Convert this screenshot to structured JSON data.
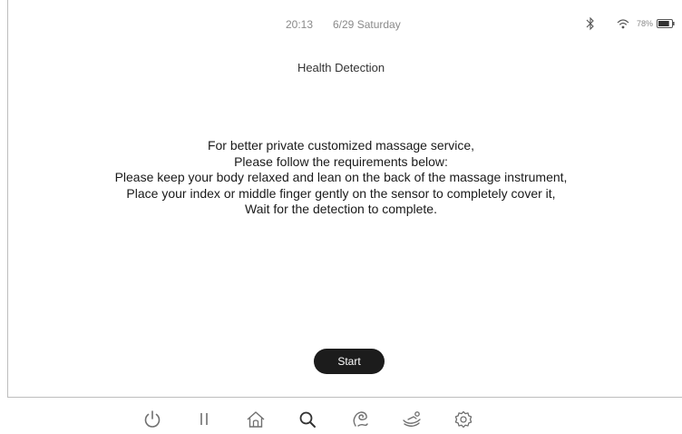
{
  "status_bar": {
    "time": "20:13",
    "date": "6/29 Saturday",
    "battery_percent": "78%",
    "battery_level": 0.78,
    "icons": [
      "bluetooth-icon",
      "wifi-icon",
      "battery-icon"
    ]
  },
  "page": {
    "title": "Health Detection",
    "instructions": [
      "For better private customized massage service,",
      "Please follow the requirements below:",
      "Please keep your body relaxed and lean on the back of the massage instrument,",
      "Place your index or middle finger gently on the sensor to completely cover it,",
      "Wait for the detection to complete."
    ],
    "start_label": "Start"
  },
  "bottom_nav": {
    "items": [
      "power-icon",
      "pause-icon",
      "home-icon",
      "search-icon",
      "massage-hand-icon",
      "recline-icon",
      "settings-icon"
    ]
  },
  "colors": {
    "start_button_bg": "#1c1c1c",
    "start_button_text": "#ffffff",
    "icon_gray": "#6f6f6f",
    "status_text": "#8a8a8a"
  }
}
